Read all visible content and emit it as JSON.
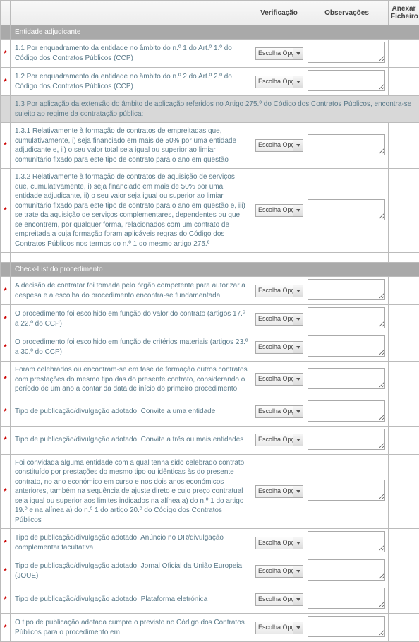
{
  "columns": {
    "verificacao": "Verificação",
    "observacoes": "Observações",
    "anexar": "Anexar Ficheiro"
  },
  "dropdown_label": "Escolha Opção",
  "asterisk": "*",
  "sections": [
    {
      "title": "Entidade adjudicante"
    },
    {
      "title": "Check-List do procedimento"
    }
  ],
  "subheader1": "1.3 Por aplicação da extensão do âmbito de aplicação referidos no Artigo 275.º do Código dos Contratos Públicos, encontra-se sujeito ao regime da contratação pública:",
  "rows_sec1": [
    {
      "text": "1.1 Por enquadramento da entidade no âmbito do n.º 1 do Art.º 1.º do Código dos Contratos Públicos (CCP)"
    },
    {
      "text": "1.2 Por enquadramento da entidade no âmbito do n.º 2 do Art.º 2.º do Código dos Contratos Públicos (CCP)"
    },
    {
      "text": "1.3.1 Relativamente à formação de contratos de empreitadas que, cumulativamente, i) seja financiado em mais de 50% por uma entidade adjudicante e, ii) o seu valor total seja igual ou superior ao limiar comunitário fixado para este tipo de contrato para o ano em questão"
    },
    {
      "text": "1.3.2 Relativamente à formação de contratos de aquisição de serviços que, cumulativamente, i) seja financiado em mais de 50% por uma entidade adjudicante, ii) o seu valor seja igual ou superior ao limiar comunitário fixado para este tipo de contrato para o ano em questão e, iii) se trate da aquisição de serviços complementares, dependentes ou que se encontrem, por qualquer forma, relacionados com um contrato de empreitada a cuja formação foram aplicáveis regras do Código dos Contratos Públicos nos termos do n.º 1 do mesmo artigo 275.º"
    }
  ],
  "rows_sec2": [
    {
      "text": "A decisão de contratar foi tomada pelo órgão competente para autorizar a despesa e a escolha do procedimento encontra-se fundamentada"
    },
    {
      "text": "O procedimento foi escolhido em função do valor do contrato (artigos 17.º a 22.º do CCP)"
    },
    {
      "text": "O procedimento foi escolhido em função de critérios materiais (artigos 23.º a 30.º do CCP)"
    },
    {
      "text": "Foram celebrados ou encontram-se em fase de formação outros contratos com prestações do mesmo tipo das do presente contrato, considerando o período de um ano a contar da data de início do primeiro procedimento"
    },
    {
      "text": "Tipo de publicação/divulgação adotado: Convite a uma entidade"
    },
    {
      "text": "Tipo de publicação/divulgação adotado: Convite a três ou mais entidades"
    },
    {
      "text": "Foi convidada alguma entidade com a qual tenha sido celebrado contrato constituído por prestações do mesmo tipo ou idênticas às do presente contrato, no ano económico em curso e nos dois anos económicos anteriores, também na sequência de ajuste direto e cujo preço contratual seja igual ou superior aos limites indicados na alínea a) do n.º 1 do artigo 19.º e na alínea a) do n.º 1 do artigo 20.º do Código dos Contratos Públicos"
    },
    {
      "text": "Tipo de publicação/divulgação adotado: Anúncio no DR/divulgação complementar facultativa"
    },
    {
      "text": "Tipo de publicação/divulgação adotado: Jornal Oficial da União Europeia (JOUE)"
    },
    {
      "text": "Tipo de publicação/divulgação adotado: Plataforma eletrónica"
    },
    {
      "text": "O tipo de publicação adotada cumpre o previsto no Código dos Contratos Públicos para o procedimento em"
    }
  ]
}
